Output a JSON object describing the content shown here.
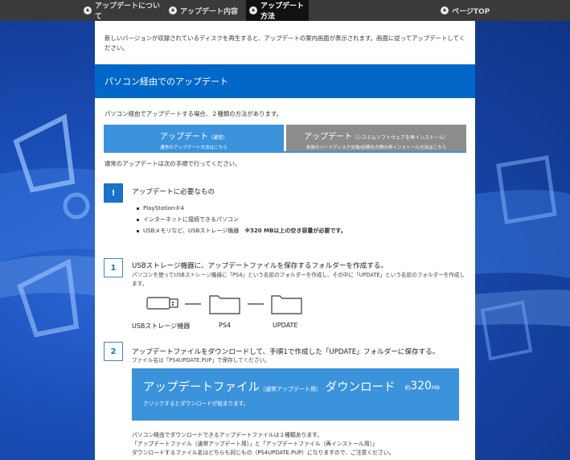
{
  "nav": {
    "items": [
      {
        "label": "アップデートについて"
      },
      {
        "label": "アップデート内容"
      },
      {
        "label": "アップデート方法"
      },
      {
        "label": "ページTOP"
      }
    ],
    "active_index": 2
  },
  "intro_text": "新しいバージョンが収録されているディスクを再生すると、アップデートの案内画面が表示されます。画面に従ってアップデートしてください。",
  "section_title": "パソコン経由でのアップデート",
  "methods_text": "パソコン経由でアップデートする場合、２種類の方法があります。",
  "tabs": [
    {
      "title": "アップデート",
      "title_note": "（通常）",
      "sub": "通常のアップデート方法はこちら"
    },
    {
      "title": "アップデート",
      "title_note": "（システムソフトウェアを再インストール）",
      "sub": "本体のハードディスク交換/初期化の際の再インストール方法はこちら"
    }
  ],
  "normal_text": "通常のアップデートは次の手順で行ってください。",
  "requirements": {
    "badge": "!",
    "title": "アップデートに必要なもの",
    "items": [
      "PlayStation®4",
      "インターネットに接続できるパソコン"
    ],
    "last_item_prefix": "USBメモリなど、USBストレージ機器　",
    "last_item_bold": "※320 MB以上の空き容量が必要です。"
  },
  "step1": {
    "number": "1",
    "title": "USBストレージ機器に、アップデートファイルを保存するフォルダーを作成する。",
    "sub": "パソコンを使ってUSBストレージ機器に「PS4」という名前のフォルダーを作成し、その中に「UPDATE」という名前のフォルダーを作成します。",
    "labels": [
      "USBストレージ機器",
      "PS4",
      "UPDATE"
    ]
  },
  "step2": {
    "number": "2",
    "title": "アップデートファイルをダウンロードして、手順1で作成した「UPDATE」フォルダーに保存する。",
    "sub": "ファイル名は「PS4UPDATE.PUP」で保存してください。"
  },
  "download": {
    "title": "アップデートファイル",
    "title_note": "（通常アップデート用）",
    "title_tail": "ダウンロード",
    "size_prefix": "約",
    "size": "320",
    "size_unit": "MB",
    "sub": "クリックするとダウンロードが始まります。"
  },
  "notes": [
    "パソコン経由でダウンロードできるアップデートファイルは２種類あります。",
    "「アップデートファイル（通常アップデート用）」と「アップデートファイル（再インストール用）」",
    "ダウンロードするファイル名はどちらも同じもの（PS4UPDATE.PUP）になりますので、ご注意ください。"
  ],
  "colors": {
    "accent": "#0068c8",
    "tab_active": "#3b93dc",
    "tab_inactive": "#8c8c8c",
    "nav_bg": "#3a3a3a"
  }
}
